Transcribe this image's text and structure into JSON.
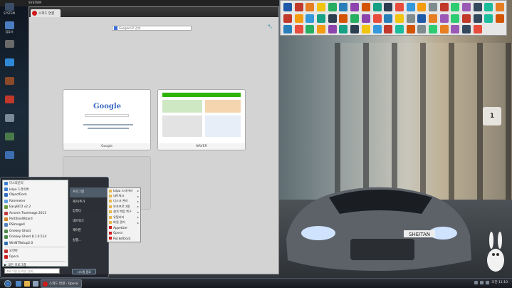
{
  "top_strip": {
    "items": [
      "SYSTEM",
      "",
      "",
      "",
      "",
      "",
      "",
      ""
    ]
  },
  "desktop_icons": [
    {
      "label": "SYSTEM",
      "color": "#3a4c66"
    },
    {
      "label": "컴퓨터",
      "color": "#4c7dc2"
    },
    {
      "label": "",
      "color": "#6a6a6a"
    },
    {
      "label": "",
      "color": "#2f89d6"
    },
    {
      "label": "",
      "color": "#8a4a2a"
    },
    {
      "label": "",
      "color": "#c0392b"
    },
    {
      "label": "",
      "color": "#7a8a99"
    },
    {
      "label": "",
      "color": "#4a7a4a"
    },
    {
      "label": "",
      "color": "#3c6db0"
    }
  ],
  "browser": {
    "app_name": "Opera",
    "tab_title": "스피드 연결",
    "search_placeholder": "Google으로 검색",
    "speed_dials": [
      {
        "caption": "Google",
        "logo_text": "Google"
      },
      {
        "caption": "NAVER"
      }
    ]
  },
  "start_menu": {
    "programs": [
      {
        "label": "다스라운터",
        "color": "#3a7fd5"
      },
      {
        "label": "Iolpa 드라이버",
        "color": "#3a7fd5"
      },
      {
        "label": "ObjectDock",
        "color": "#2d6bbf"
      },
      {
        "label": "Rainmeter",
        "color": "#5aa0e0"
      },
      {
        "label": "EasyBCD v2.2",
        "color": "#6a9a3a"
      },
      {
        "label": "Acronis TrueImage 2013",
        "color": "#c23b3b"
      },
      {
        "label": "PartitionWizard",
        "color": "#d3862b"
      },
      {
        "label": "RSImageX",
        "color": "#5080c0"
      },
      {
        "label": "Onekey Ghost",
        "color": "#4a8a4a"
      },
      {
        "label": "Onekey Ghost 8.1.0.514",
        "color": "#4a8a4a"
      },
      {
        "label": "WinNTSetup2.0",
        "color": "#3070b0"
      },
      {
        "label": "오연아",
        "color": "#c23030"
      },
      {
        "label": "Opera",
        "color": "#d01b1b"
      }
    ],
    "all_programs": "모든 프로그램",
    "search_placeholder": "프로그램 및 파일 검색",
    "right_items": [
      "프로그램",
      "제거/추가",
      "컴퓨터",
      "네트워크",
      "제어판",
      "실행..."
    ],
    "shutdown_label": "시스템 종료",
    "submenu": [
      {
        "label": "Iolpa 드라이버",
        "has_arrow": true
      },
      {
        "label": "네트워크",
        "has_arrow": true
      },
      {
        "label": "디스크 관리",
        "has_arrow": true
      },
      {
        "label": "보조프로그램",
        "has_arrow": true
      },
      {
        "label": "설치 백업 복구",
        "has_arrow": true
      },
      {
        "label": "유틸리티",
        "has_arrow": true
      },
      {
        "label": "파일 관리",
        "has_arrow": true
      },
      {
        "label": "Appetizer",
        "has_arrow": false
      },
      {
        "label": "Opera",
        "has_arrow": false
      },
      {
        "label": "RocketDock",
        "has_arrow": false
      }
    ]
  },
  "icon_grid_colors": [
    "#1e5aa8",
    "#c0392b",
    "#e67e22",
    "#f1c40f",
    "#27ae60",
    "#2980b9",
    "#8e44ad",
    "#d35400",
    "#16a085",
    "#2c3e50",
    "#e74c3c",
    "#3498db",
    "#f39c12",
    "#7f8c8d",
    "#c0392b",
    "#2ecc71",
    "#9b59b6",
    "#34495e",
    "#1abc9c",
    "#e67e22",
    "#c0392b",
    "#f39c12",
    "#3498db",
    "#16a085",
    "#2c3e50",
    "#d35400",
    "#27ae60",
    "#8e44ad",
    "#e74c3c",
    "#2980b9",
    "#f1c40f",
    "#7f8c8d",
    "#1e5aa8",
    "#e67e22",
    "#9b59b6",
    "#2ecc71",
    "#c0392b",
    "#34495e",
    "#1abc9c",
    "#d35400",
    "#2980b9",
    "#e74c3c",
    "#27ae60",
    "#f39c12",
    "#8e44ad",
    "#16a085",
    "#2c3e50",
    "#f1c40f",
    "#3498db",
    "#c0392b",
    "#1abc9c",
    "#d35400",
    "#7f8c8d",
    "#2ecc71",
    "#e67e22",
    "#9b59b6",
    "#34495e",
    "#e74c3c"
  ],
  "clock_sign": "1",
  "taskbar": {
    "task_label": "스피드 연결 - Opera",
    "time": "오전 11:10"
  },
  "wallpaper": {
    "plate_text": "SHEITAN"
  }
}
